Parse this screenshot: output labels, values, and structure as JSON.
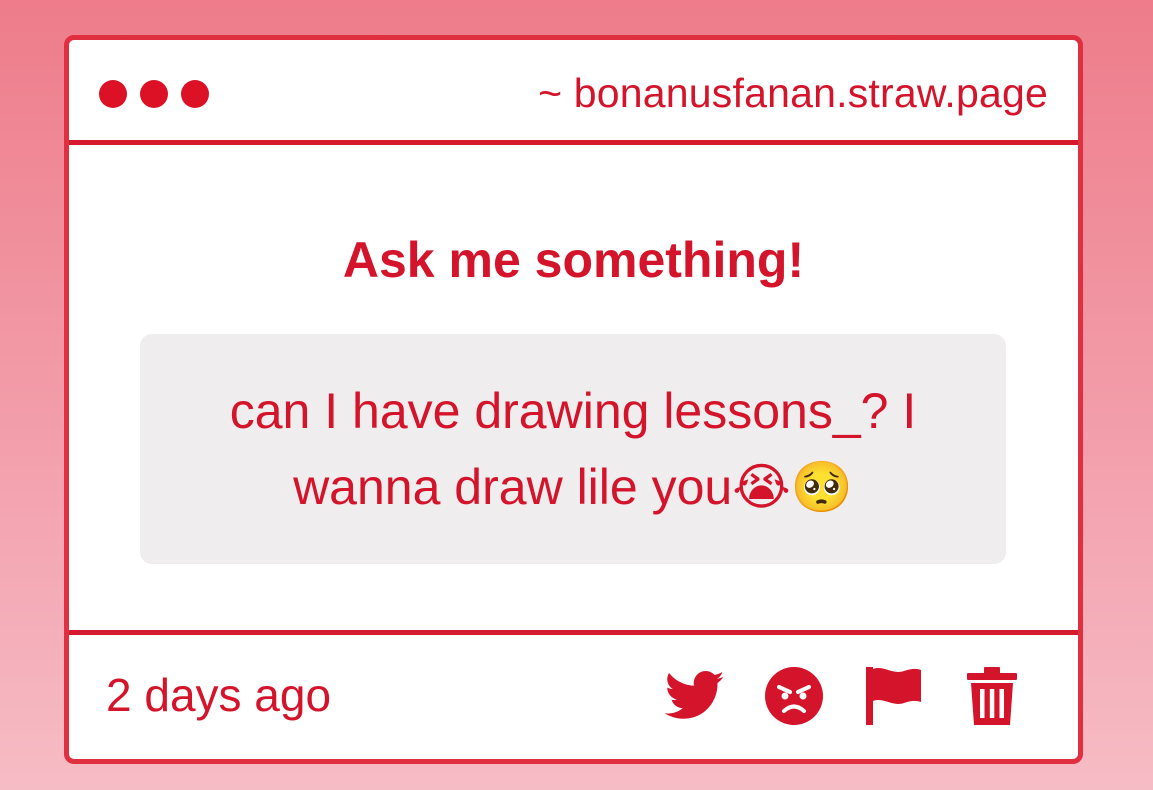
{
  "window": {
    "url": "~ bonanusfanan.straw.page"
  },
  "question": {
    "heading": "Ask me something!",
    "text": "can I have drawing lessons_? I wanna draw lile you",
    "emojis": [
      "😭",
      "🥺"
    ]
  },
  "footer": {
    "timestamp": "2 days ago",
    "actions": [
      {
        "name": "twitter-share",
        "icon": "twitter-bird-icon"
      },
      {
        "name": "angry-reaction",
        "icon": "angry-face-icon"
      },
      {
        "name": "report",
        "icon": "flag-icon"
      },
      {
        "name": "delete",
        "icon": "trash-icon"
      }
    ]
  },
  "colors": {
    "accent": "#d4142a",
    "border": "#e0303f",
    "card": "#efedee",
    "background_top": "#ee7c8a",
    "background_bottom": "#f6bcc5"
  }
}
